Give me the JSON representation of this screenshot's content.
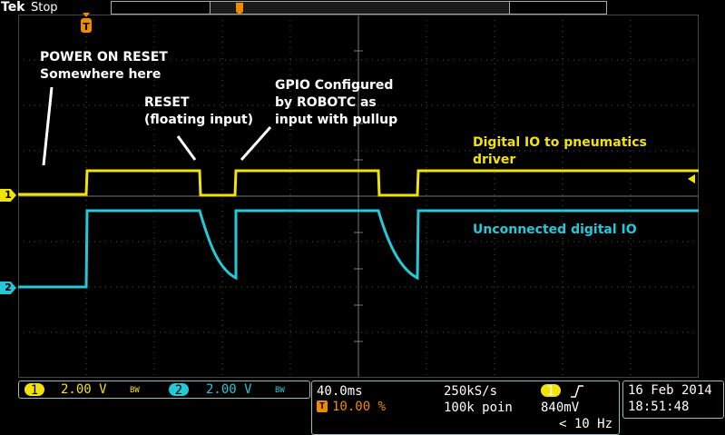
{
  "header": {
    "brand": "Tek",
    "status": "Stop"
  },
  "annotations": {
    "power_on_line1": "POWER ON RESET",
    "power_on_line2": "Somewhere here",
    "reset_line1": "RESET",
    "reset_line2": "(floating input)",
    "gpio_line1": "GPIO Configured",
    "gpio_line2": "by ROBOTC as",
    "gpio_line3": "input with pullup",
    "yellow_line1": "Digital IO to pneumatics",
    "yellow_line2": "driver",
    "cyan_line1": "Unconnected digital IO"
  },
  "channels": {
    "ch1_label": "1",
    "ch2_label": "2",
    "ch1_scale": "2.00 V",
    "ch2_scale": "2.00 V",
    "ch1_bw": "BW",
    "ch2_bw": "BW",
    "ch1_color": "#f1e20a",
    "ch2_color": "#26c8d8"
  },
  "timebase": {
    "time_div": "40.0ms",
    "trigger_pos": "10.00 %",
    "sample_rate": "250kS/s",
    "record_length": "100k poin",
    "trigger_source": "1",
    "trigger_level": "840mV",
    "trigger_freq": "< 10 Hz"
  },
  "datetime": {
    "date": "16 Feb  2014",
    "time": "18:51:48"
  },
  "icons": {
    "trigger_marker": "T",
    "trigger_edge": "rising-edge-icon"
  }
}
